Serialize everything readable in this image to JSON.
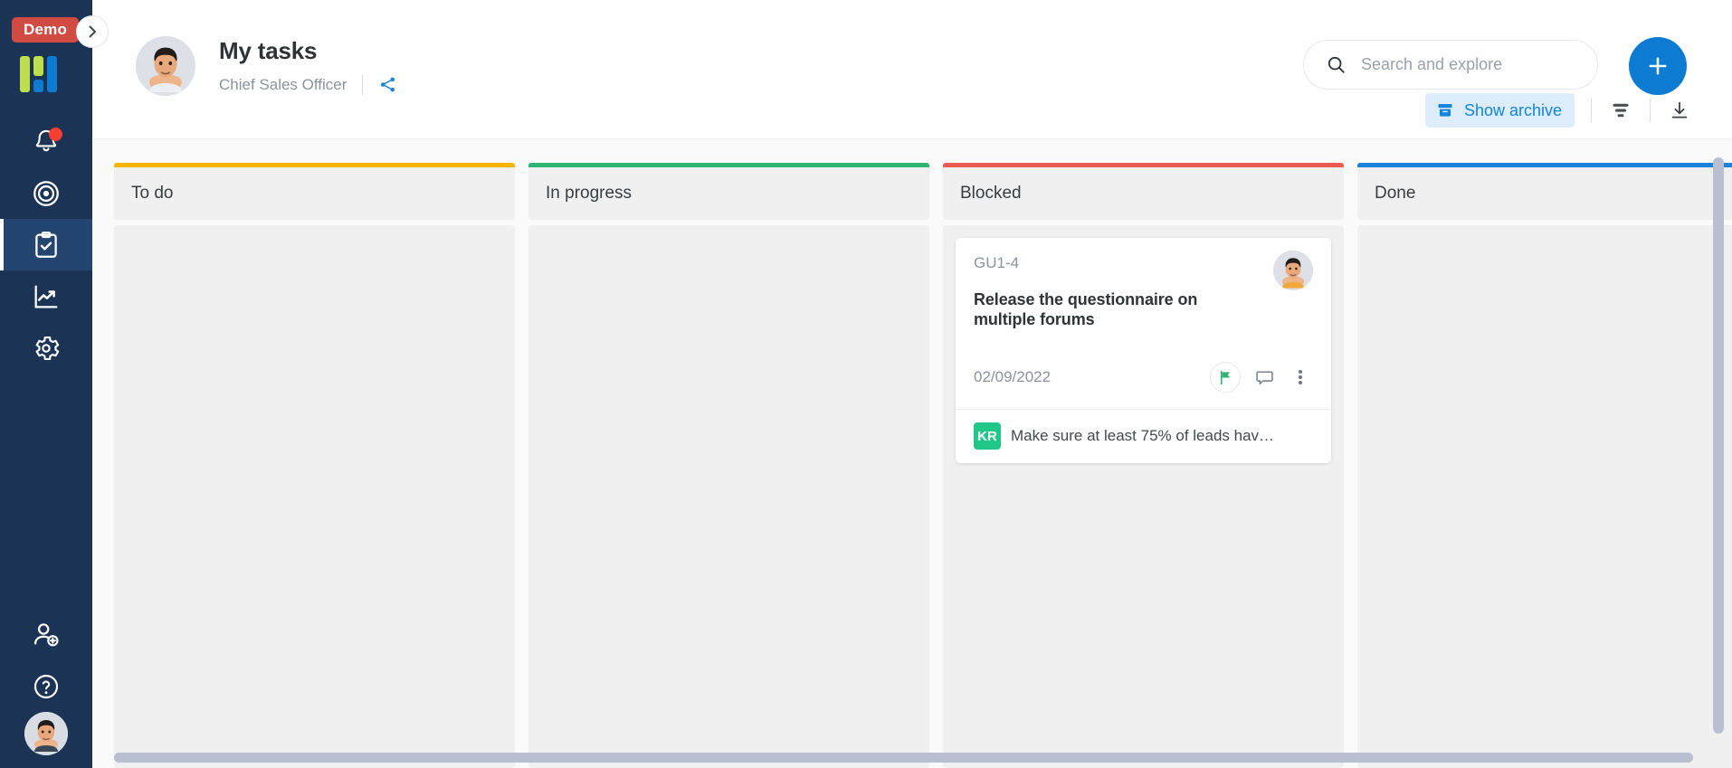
{
  "sidebar": {
    "demo_badge": "Demo",
    "logo_name": "app-logo",
    "colors": {
      "bg": "#1b3354",
      "active": "#24456f",
      "badge": "#d24b43",
      "dot": "#f43f32",
      "logo_green": "#bede4e",
      "logo_blue": "#0c7bd1"
    },
    "items": [
      {
        "name": "notifications-icon",
        "label": "Notifications",
        "badge": true
      },
      {
        "name": "goals-icon",
        "label": "Goals",
        "badge": false
      },
      {
        "name": "tasks-icon",
        "label": "Tasks",
        "badge": false,
        "active": true
      },
      {
        "name": "analytics-icon",
        "label": "Analytics",
        "badge": false
      },
      {
        "name": "settings-icon",
        "label": "Settings",
        "badge": false
      }
    ],
    "bottom_items": [
      {
        "name": "invite-user-icon",
        "label": "Invite user"
      },
      {
        "name": "help-icon",
        "label": "Help"
      },
      {
        "name": "user-avatar",
        "label": "Account"
      }
    ]
  },
  "header": {
    "title": "My tasks",
    "subtitle": "Chief Sales Officer",
    "share_icon": "share-icon",
    "avatar": "user-avatar"
  },
  "search": {
    "placeholder": "Search and explore",
    "value": "",
    "icon": "search-icon"
  },
  "create": {
    "label": "+",
    "icon": "plus-icon",
    "color": "#0c7bd1"
  },
  "toolbar": {
    "archive_label": "Show archive",
    "archive_icon": "archive-icon",
    "filter_icon": "filter-icon",
    "download_icon": "download-icon",
    "accent": "#1384e0"
  },
  "board": {
    "columns": [
      {
        "title": "To do",
        "accent": "#f7b500",
        "cards": []
      },
      {
        "title": "In progress",
        "accent": "#2ab673",
        "cards": []
      },
      {
        "title": "Blocked",
        "accent": "#ea5b54",
        "cards": [
          {
            "id": "GU1-4",
            "title": "Release the questionnaire on multiple forums",
            "date": "02/09/2022",
            "assignee_avatar": "user-avatar",
            "flag_icon": "flag-icon",
            "comment_icon": "comment-icon",
            "more_icon": "more-vertical-icon",
            "kr_badge": "KR",
            "kr_text": "Make sure at least 75% of leads hav…"
          }
        ]
      },
      {
        "title": "Done",
        "accent": "#1a84db",
        "cards": []
      }
    ]
  },
  "scrollbars": {
    "vertical": "vertical-scrollbar",
    "horizontal": "horizontal-scrollbar"
  }
}
